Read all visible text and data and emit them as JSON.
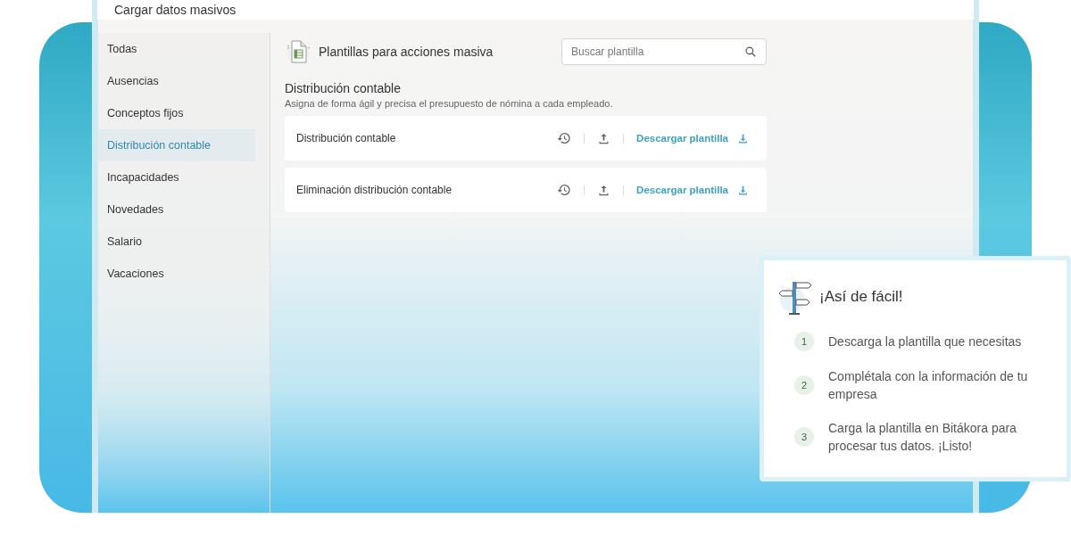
{
  "window": {
    "title": "Cargar datos masivos"
  },
  "sidebar": {
    "items": [
      {
        "label": "Todas",
        "selected": false
      },
      {
        "label": "Ausencias",
        "selected": false
      },
      {
        "label": "Conceptos fijos",
        "selected": false
      },
      {
        "label": "Distribución contable",
        "selected": true
      },
      {
        "label": "Incapacidades",
        "selected": false
      },
      {
        "label": "Novedades",
        "selected": false
      },
      {
        "label": "Salario",
        "selected": false
      },
      {
        "label": "Vacaciones",
        "selected": false
      }
    ]
  },
  "header": {
    "title": "Plantillas para acciones masiva",
    "search": {
      "placeholder": "Buscar plantilla"
    }
  },
  "section": {
    "title": "Distribución contable",
    "description": "Asigna de forma ágil y precisa el presupuesto de nómina a cada empleado.",
    "templates": [
      {
        "name": "Distribución contable",
        "download": "Descargar plantilla"
      },
      {
        "name": "Eliminación distribución contable",
        "download": "Descargar plantilla"
      }
    ]
  },
  "help_card": {
    "title": "¡Así de fácil!",
    "steps": [
      {
        "number": "1",
        "text": "Descarga la plantilla que necesitas"
      },
      {
        "number": "2",
        "text": "Complétala con la información de tu empresa"
      },
      {
        "number": "3",
        "text": "Carga la plantilla en Bitákora para procesar tus datos. ¡Listo!"
      }
    ]
  }
}
